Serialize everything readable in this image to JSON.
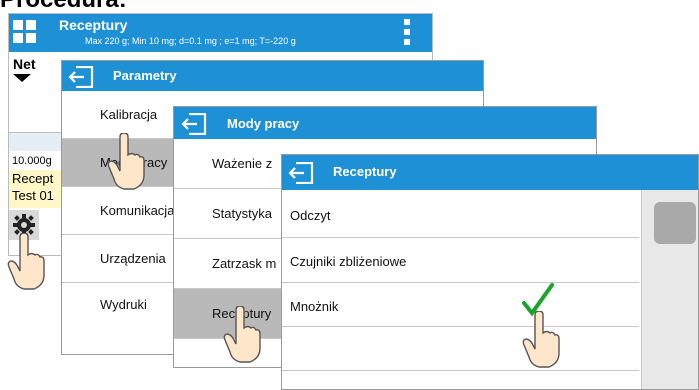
{
  "caption": "Procedura:",
  "main_screen": {
    "title": "Receptury",
    "subtitle": "Max 220 g; Min 10 mg; d=0.1 mg ; e=1 mg; T=-220 g",
    "net_label": "Net",
    "mass_value": "10.000g",
    "info_line1": "Recept",
    "info_line2": "Test 01",
    "grid_icon": "grid-icon",
    "menu_icon": "kebab-menu-icon",
    "settings_icon": "gear-icon"
  },
  "parametry": {
    "title": "Parametry",
    "items": [
      "Kalibracja",
      "Mody pracy",
      "Komunikacja",
      "Urządzenia",
      "Wydruki"
    ]
  },
  "mody_pracy": {
    "title": "Mody pracy",
    "items": [
      "Ważenie z",
      "Statystyka",
      "Zatrzask m",
      "Receptury"
    ]
  },
  "receptury": {
    "title": "Receptury",
    "items": [
      "Odczyt",
      "Czujniki zbliżeniowe",
      "Mnożnik"
    ],
    "checked_item": "Mnożnik",
    "check_color": "#1aa32a"
  },
  "colors": {
    "header": "#1e90d6",
    "selected": "#b9b9b9"
  }
}
